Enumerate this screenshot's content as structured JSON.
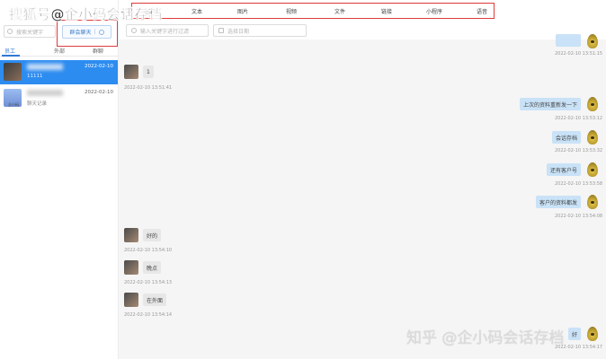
{
  "watermarks": {
    "top": "搜狐号@企小码会话存档",
    "bottom": "知乎 @企小码会话存档"
  },
  "left": {
    "search_placeholder": "搜索关键字",
    "group_button": "群会聊天",
    "tabs": [
      "员工",
      "外部",
      "群聊"
    ],
    "conversations": [
      {
        "date": "2022-02-10",
        "preview": "11111",
        "selected": true
      },
      {
        "date": "2022-02-10",
        "preview": "聊天记录",
        "avatar_label": "企小码",
        "selected": false
      }
    ]
  },
  "filters": {
    "tabs": [
      "全部",
      "文本",
      "图片",
      "视频",
      "文件",
      "链接",
      "小程序",
      "语音"
    ],
    "keyword_placeholder": "输入关键字进行过滤",
    "date_placeholder": "选择日期"
  },
  "messages": [
    {
      "dir": "out",
      "text": "",
      "time": "2022-02-10 13:51:15"
    },
    {
      "dir": "in",
      "text": "1",
      "time": "2022-02-10 13:51:41"
    },
    {
      "dir": "out",
      "text": "上次的资料重新发一下",
      "time": "2022-02-10 13:53:12"
    },
    {
      "dir": "out",
      "text": "会话存档",
      "time": "2022-02-10 13:53:32"
    },
    {
      "dir": "out",
      "text": "还有客户号",
      "time": "2022-02-10 13:53:58"
    },
    {
      "dir": "out",
      "text": "客户的资料都发",
      "time": "2022-02-10 13:54:08"
    },
    {
      "dir": "in",
      "text": "好的",
      "time": "2022-02-10 13:54:10"
    },
    {
      "dir": "in",
      "text": "晚点",
      "time": "2022-02-10 13:54:13"
    },
    {
      "dir": "in",
      "text": "在外面",
      "time": "2022-02-10 13:54:14"
    },
    {
      "dir": "out",
      "text": "好",
      "time": "2022-02-10 13:54:17"
    }
  ],
  "colors": {
    "accent": "#2d8cf0",
    "highlight_box": "#e03a3a",
    "bubble_out": "#c9e2f7",
    "bubble_in": "#e7e7e7"
  }
}
